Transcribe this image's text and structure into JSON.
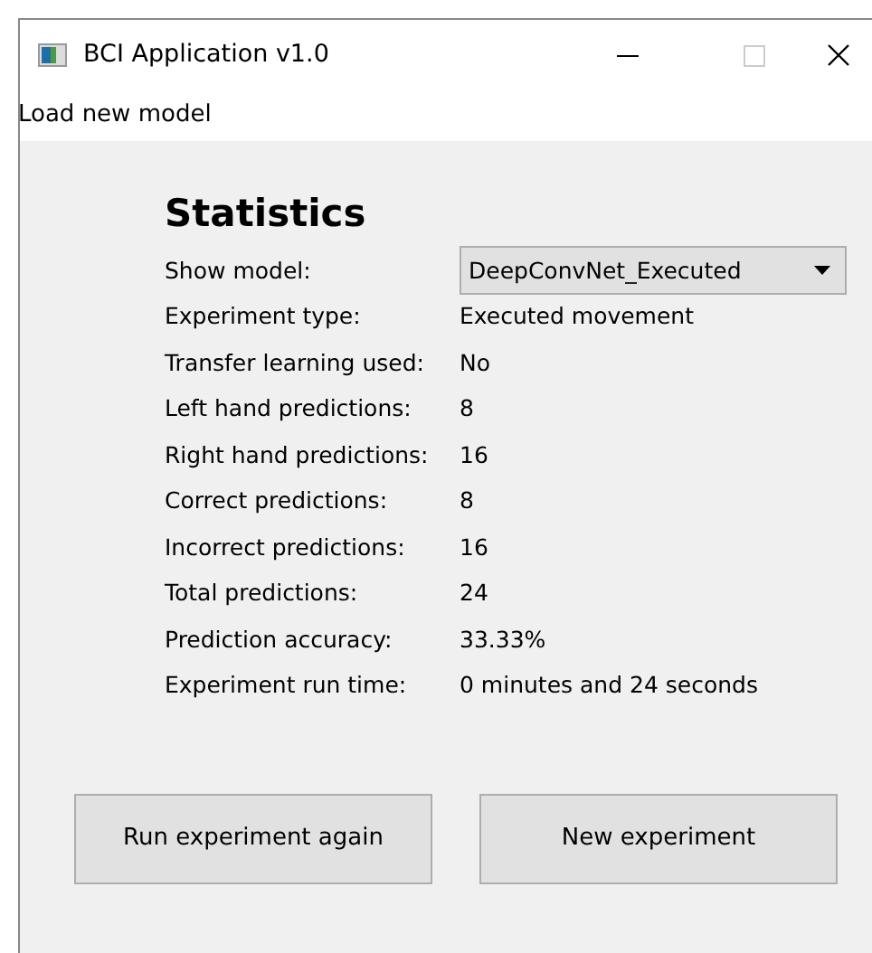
{
  "window": {
    "title": "BCI Application v1.0"
  },
  "menu": [
    "Load new model"
  ],
  "heading": "Statistics",
  "rows": [
    {
      "kind": "dropdown",
      "label": "Show model:",
      "value": "DeepConvNet_Executed"
    },
    {
      "kind": "text",
      "label": "Experiment type:",
      "value": "Executed movement"
    },
    {
      "kind": "text",
      "label": "Transfer learning used:",
      "value": "No"
    },
    {
      "kind": "text",
      "label": "Left hand predictions:",
      "value": "8"
    },
    {
      "kind": "text",
      "label": "Right hand predictions:",
      "value": "16"
    },
    {
      "kind": "text",
      "label": "Correct predictions:",
      "value": "8"
    },
    {
      "kind": "text",
      "label": "Incorrect predictions:",
      "value": "16"
    },
    {
      "kind": "text",
      "label": "Total predictions:",
      "value": "24"
    },
    {
      "kind": "text",
      "label": "Prediction accuracy:",
      "value": "33.33%"
    },
    {
      "kind": "text",
      "label": "Experiment run time:",
      "value": "0 minutes and 24 seconds"
    }
  ],
  "buttons": [
    "Run experiment again",
    "New experiment"
  ]
}
